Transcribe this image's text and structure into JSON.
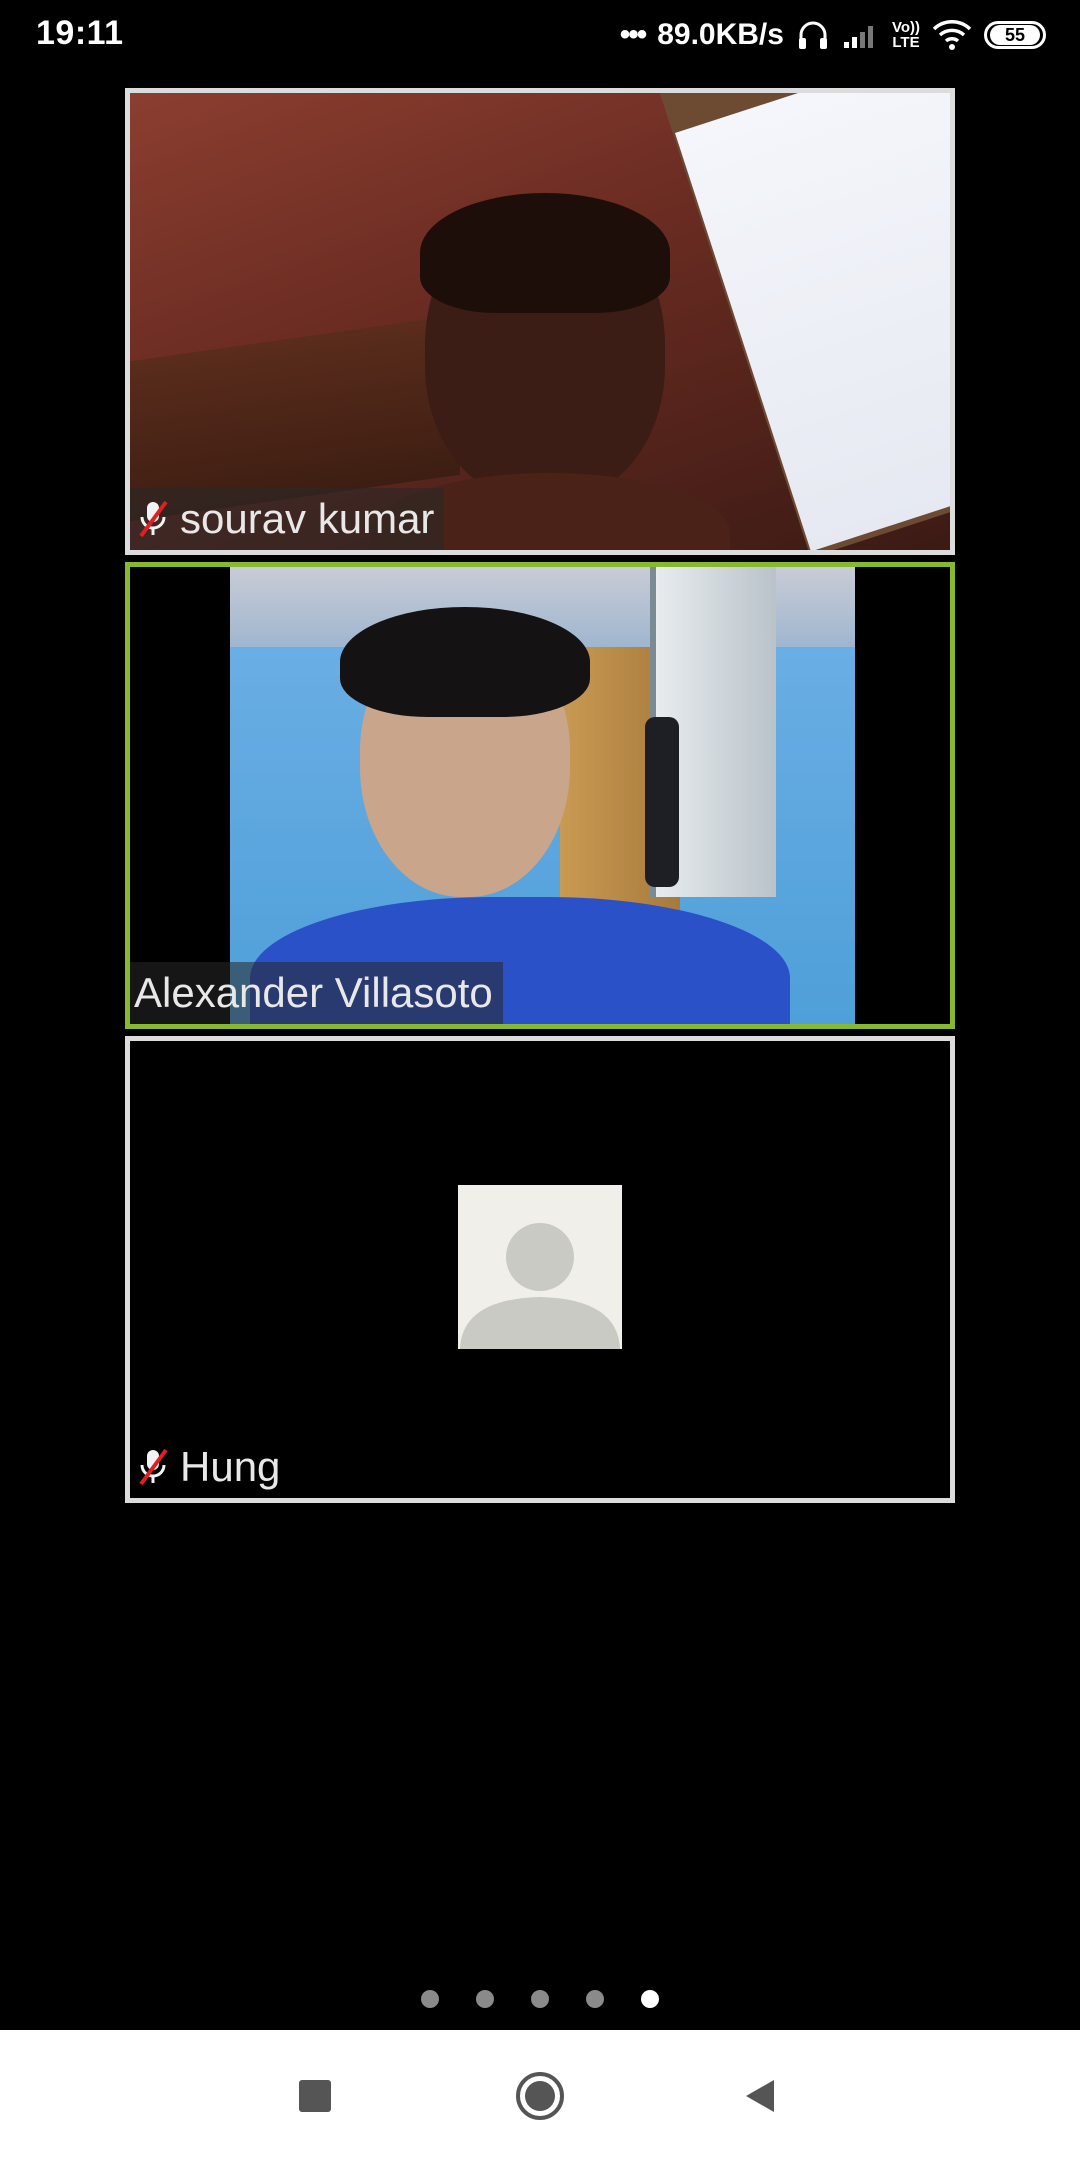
{
  "status_bar": {
    "time": "19:11",
    "dots": "•••",
    "network_speed": "89.0KB/s",
    "icons": [
      "headphones-icon",
      "signal-bars-icon",
      "volte-lte-icon",
      "wifi-icon"
    ],
    "volte_top": "Vo))",
    "volte_bottom": "LTE",
    "battery_percent": "55"
  },
  "participants": [
    {
      "name": "sourav kumar",
      "muted": true,
      "video": "on"
    },
    {
      "name": "Alexander Villasoto",
      "muted": false,
      "video": "on",
      "active_speaker": true
    },
    {
      "name": "Hung",
      "muted": true,
      "video": "off",
      "avatar_icon": "default-avatar-icon"
    }
  ],
  "pager": {
    "total_pages": 5,
    "current_page": 5
  },
  "nav_bar": {
    "buttons": [
      "recents-icon",
      "home-icon",
      "back-icon"
    ]
  },
  "colors": {
    "active_border": "#86b92f",
    "tile_border": "#dcdcdc",
    "mute_slash": "#e02020"
  }
}
